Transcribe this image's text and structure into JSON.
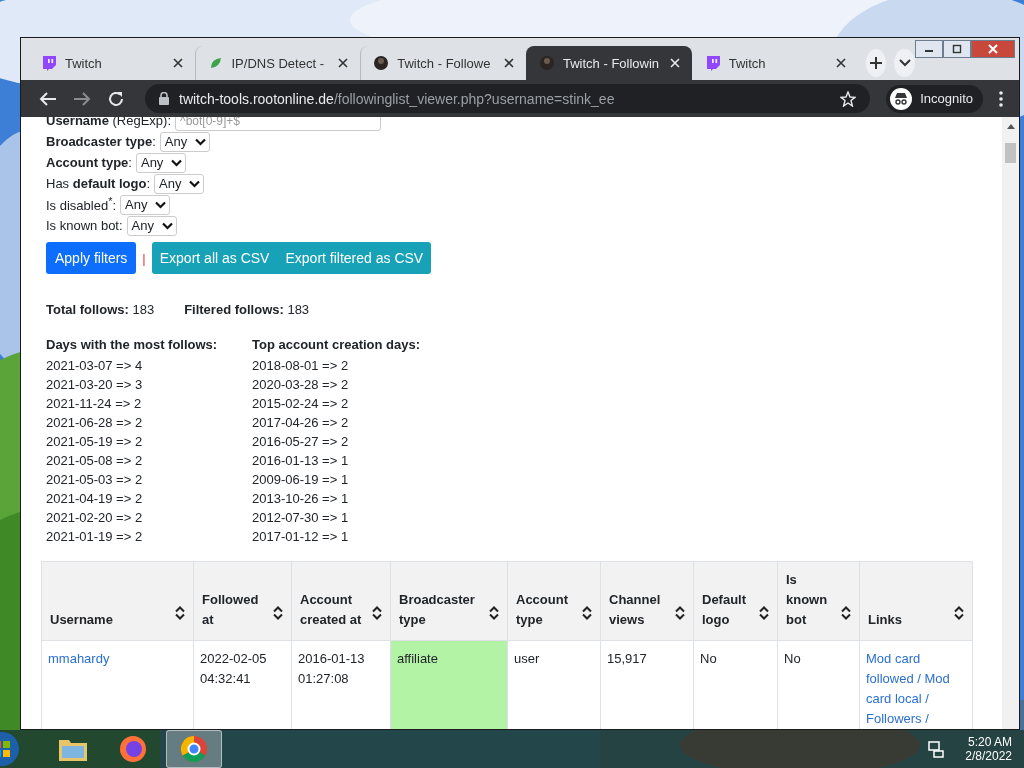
{
  "tabs": [
    {
      "title": "Twitch",
      "kind": "twitch",
      "selected": false
    },
    {
      "title": "IP/DNS Detect -",
      "kind": "leaf",
      "selected": false
    },
    {
      "title": "Twitch - Followe",
      "kind": "avatar",
      "selected": false
    },
    {
      "title": "Twitch - Followin",
      "kind": "avatar",
      "selected": true
    },
    {
      "title": "Twitch",
      "kind": "twitch",
      "selected": false
    }
  ],
  "address": {
    "host": "twitch-tools.rootonline.de",
    "path": "/followinglist_viewer.php?username=stink_ee"
  },
  "incognito": "Incognito",
  "filters": [
    {
      "label": "**Username** (RegExp):",
      "kind": "text",
      "placeholder": "^bot[0-9]+$"
    },
    {
      "label": "**Broadcaster type**:",
      "kind": "select",
      "value": "Any"
    },
    {
      "label": "**Account type**:",
      "kind": "select",
      "value": "Any"
    },
    {
      "label": "Has **default logo**:",
      "kind": "select",
      "value": "Any"
    },
    {
      "label": "Is disabled$^{*}$:",
      "kind": "select",
      "value": "Any"
    },
    {
      "label": "Is known bot:",
      "kind": "select",
      "value": "Any"
    }
  ],
  "buttons": {
    "apply": "Apply filters",
    "separator": "|",
    "export": [
      "Export all as CSV",
      "Export filtered as CSV"
    ]
  },
  "stats": [
    {
      "label": "Total follows:",
      "value": "183"
    },
    {
      "label": "Filtered follows:",
      "value": "183"
    }
  ],
  "lists": [
    {
      "title": "Days with the most follows:",
      "items": [
        "2021-03-07 => 4",
        "2021-03-20 => 3",
        "2021-11-24 => 2",
        "2021-06-28 => 2",
        "2021-05-19 => 2",
        "2021-05-08 => 2",
        "2021-05-03 => 2",
        "2021-04-19 => 2",
        "2021-02-20 => 2",
        "2021-01-19 => 2"
      ]
    },
    {
      "title": "Top account creation days:",
      "items": [
        "2018-08-01 => 2",
        "2020-03-28 => 2",
        "2015-02-24 => 2",
        "2017-04-26 => 2",
        "2016-05-27 => 2",
        "2016-01-13 => 1",
        "2009-06-19 => 1",
        "2013-10-26 => 1",
        "2012-07-30 => 1",
        "2017-01-12 => 1"
      ]
    }
  ],
  "table": {
    "columns": [
      "Username",
      "Followed at",
      "Account created at",
      "Broadcaster type",
      "Account type",
      "Channel views",
      "Default logo",
      "Is known bot",
      "Links"
    ],
    "rows": [
      {
        "username": "mmahardy",
        "followed_at": "2022-02-05 04:32:41",
        "created_at": "2016-01-13 01:27:08",
        "broadcaster_type": {
          "text": "affiliate",
          "color": "#b3f3a6"
        },
        "account_type": "user",
        "channel_views": "15,917",
        "default_logo": "No",
        "known_bot": "No",
        "links": "Mod card followed / Mod card local / Followers /"
      }
    ]
  },
  "taskbar": {
    "apps": [
      {
        "kind": "explorer",
        "selected": false
      },
      {
        "kind": "firefox",
        "selected": false
      },
      {
        "kind": "chrome",
        "selected": true
      }
    ],
    "time": "5:20 AM",
    "date": "2/8/2022"
  }
}
